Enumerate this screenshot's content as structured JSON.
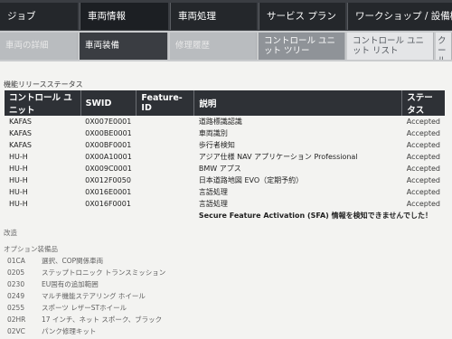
{
  "main_tabs": [
    {
      "label": "ジョブ"
    },
    {
      "label": "車両情報"
    },
    {
      "label": "車両処理"
    },
    {
      "label": "サービス プラン"
    },
    {
      "label": "ワークショップ / 設備機"
    }
  ],
  "sub_tabs": [
    {
      "label": "車両の詳細"
    },
    {
      "label": "車両装備"
    },
    {
      "label": "修理履歴"
    },
    {
      "label": "コントロール ユニット ツリー"
    },
    {
      "label": "コントロール ユニット リスト"
    },
    {
      "label": "ク ール"
    }
  ],
  "feature_release": {
    "title": "機能リリースステータス",
    "columns": [
      "コントロール ユニット",
      "SWID",
      "Feature-ID",
      "説明",
      "ステータス"
    ],
    "rows": [
      {
        "unit": "KAFAS",
        "swid": "0X007E0001",
        "feature_id": "",
        "desc": "道路標識認識",
        "status": "Accepted"
      },
      {
        "unit": "KAFAS",
        "swid": "0X00BE0001",
        "feature_id": "",
        "desc": "車両識別",
        "status": "Accepted"
      },
      {
        "unit": "KAFAS",
        "swid": "0X00BF0001",
        "feature_id": "",
        "desc": "歩行者検知",
        "status": "Accepted"
      },
      {
        "unit": "HU-H",
        "swid": "0X00A10001",
        "feature_id": "",
        "desc": "アジア仕様 NAV アプリケーション Professional",
        "status": "Accepted"
      },
      {
        "unit": "HU-H",
        "swid": "0X009C0001",
        "feature_id": "",
        "desc": "BMW アプス",
        "status": "Accepted"
      },
      {
        "unit": "HU-H",
        "swid": "0X012F0050",
        "feature_id": "",
        "desc": "日本道路地図 EVO（定期予約）",
        "status": "Accepted"
      },
      {
        "unit": "HU-H",
        "swid": "0X016E0001",
        "feature_id": "",
        "desc": "言語処理",
        "status": "Accepted"
      },
      {
        "unit": "HU-H",
        "swid": "0X016F0001",
        "feature_id": "",
        "desc": "言語処理",
        "status": "Accepted"
      }
    ],
    "message": "Secure Feature Activation (SFA) 情報を検知できませんでした！"
  },
  "misc_label": "改造",
  "options": {
    "title": "オプション装備品",
    "items": [
      {
        "code": "01CA",
        "desc": "選択、COP関係車両"
      },
      {
        "code": "0205",
        "desc": "ステップトロニック トランスミッション"
      },
      {
        "code": "0230",
        "desc": "EU国有の追加範囲"
      },
      {
        "code": "0249",
        "desc": "マルチ機能ステアリング ホイール"
      },
      {
        "code": "0255",
        "desc": "スポーツ レザーSTホイール"
      },
      {
        "code": "02HR",
        "desc": "17 インチ、ネット スポーク、ブラック"
      },
      {
        "code": "02VC",
        "desc": "パンク修理キット"
      }
    ]
  }
}
